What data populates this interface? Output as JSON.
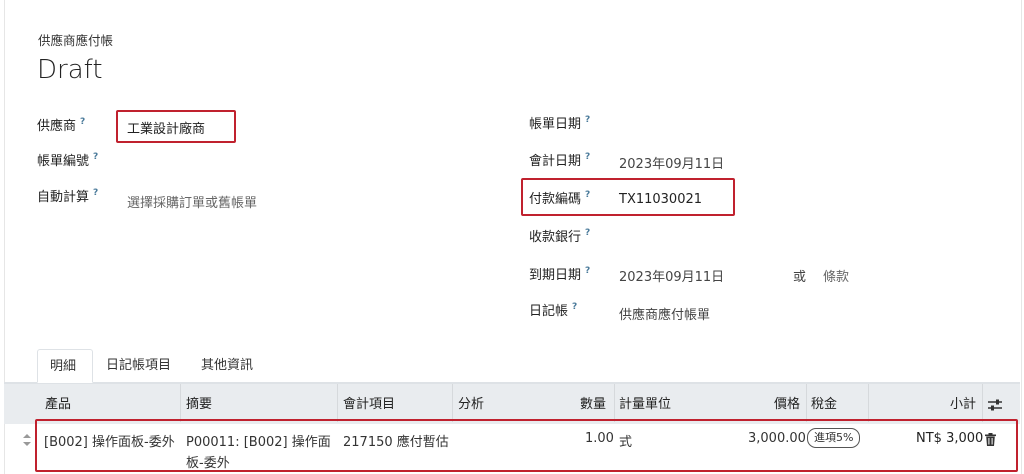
{
  "document": {
    "type_label": "供應商應付帳",
    "status": "Draft"
  },
  "form_left": {
    "vendor_label": "供應商",
    "vendor_value": "工業設計廠商",
    "bill_ref_label": "帳單編號",
    "auto_complete_label": "自動計算",
    "auto_complete_placeholder": "選擇採購訂單或舊帳單"
  },
  "form_right": {
    "bill_date_label": "帳單日期",
    "accounting_date_label": "會計日期",
    "accounting_date_value": "2023年09月11日",
    "payment_ref_label": "付款編碼",
    "payment_ref_value": "TX11030021",
    "recipient_bank_label": "收款銀行",
    "due_date_label": "到期日期",
    "due_date_value": "2023年09月11日",
    "or_label": "或",
    "terms_label": "條款",
    "journal_label": "日記帳",
    "journal_value": "供應商應付帳單"
  },
  "help_mark": "?",
  "tabs": [
    "明細",
    "日記帳項目",
    "其他資訊"
  ],
  "table": {
    "columns": [
      "產品",
      "摘要",
      "會計項目",
      "分析",
      "數量",
      "計量單位",
      "價格",
      "稅金",
      "小計"
    ],
    "rows": [
      {
        "product": "[B002] 操作面板-委外",
        "description_line1": "P00011: [B002] 操作面",
        "description_line2": "板-委外",
        "account": "217150 應付暫估",
        "quantity": "1.00",
        "uom": "式",
        "price": "3,000.00",
        "tax": "進項5%",
        "subtotal": "NT$ 3,000"
      }
    ]
  },
  "icons": {
    "drag_handle": "drag-handle-icon",
    "delete": "trash-icon",
    "column_settings": "sliders-icon"
  },
  "colors": {
    "highlight_border": "#c0212e",
    "header_bg": "#e9ecef",
    "help_mark": "#4a7a9a"
  }
}
